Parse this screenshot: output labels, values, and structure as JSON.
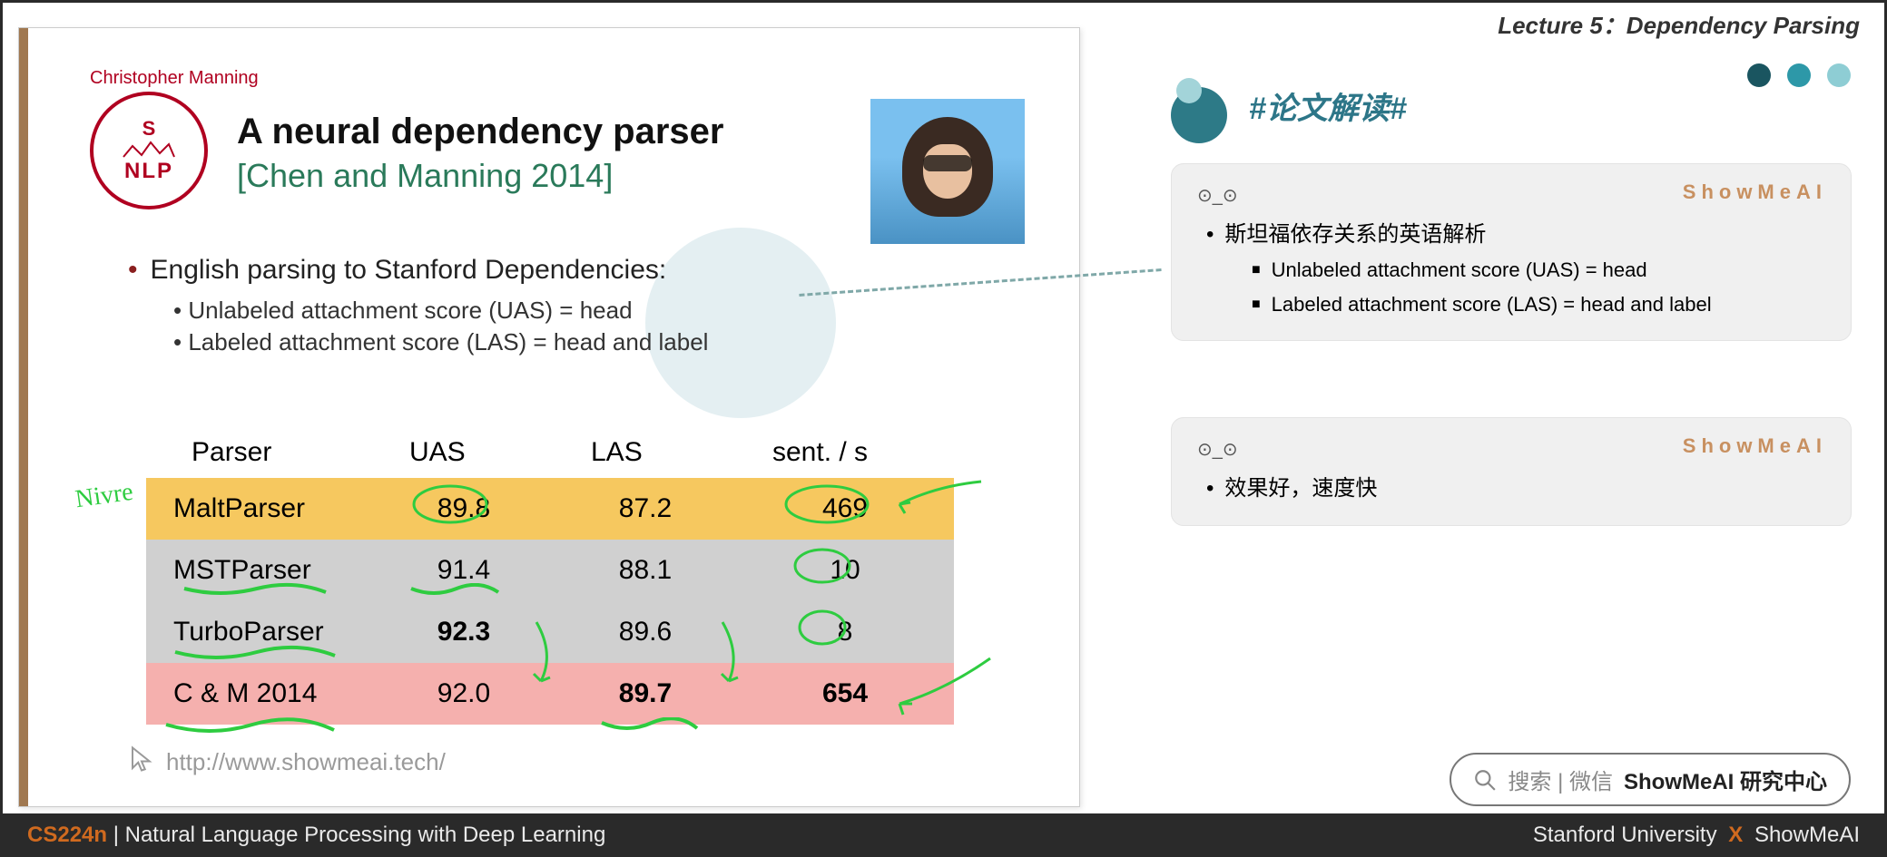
{
  "header": {
    "lecture": "Lecture 5：Dependency Parsing"
  },
  "slide": {
    "author": "Christopher Manning",
    "logo_top": "S",
    "logo_bottom": "NLP",
    "title": "A neural dependency parser",
    "subtitle": "[Chen and Manning 2014]",
    "bullet_main": "English parsing to Stanford Dependencies:",
    "sub1": "Unlabeled attachment score (UAS) = head",
    "sub2": "Labeled attachment score (LAS) = head and label",
    "hand_note": "Nivre",
    "url": "http://www.showmeai.tech/"
  },
  "chart_data": {
    "type": "table",
    "columns": [
      "Parser",
      "UAS",
      "LAS",
      "sent. / s"
    ],
    "rows": [
      {
        "parser": "MaltParser",
        "uas": "89.8",
        "las": "87.2",
        "sps": "469",
        "color": "yellow",
        "bold": []
      },
      {
        "parser": "MSTParser",
        "uas": "91.4",
        "las": "88.1",
        "sps": "10",
        "color": "gray",
        "bold": []
      },
      {
        "parser": "TurboParser",
        "uas": "92.3",
        "las": "89.6",
        "sps": "8",
        "color": "gray",
        "bold": [
          "uas"
        ]
      },
      {
        "parser": "C & M 2014",
        "uas": "92.0",
        "las": "89.7",
        "sps": "654",
        "color": "pink",
        "bold": [
          "las",
          "sps"
        ]
      }
    ]
  },
  "right": {
    "section_title": "#论文解读#",
    "brand": "ShowMeAI",
    "robot": "⊙_⊙",
    "card_a_main": "斯坦福依存关系的英语解析",
    "card_a_sub1": "Unlabeled attachment score (UAS) = head",
    "card_a_sub2": "Labeled attachment score (LAS) = head and label",
    "card_b_main": "效果好，速度快"
  },
  "search": {
    "icon": "search",
    "hint": "搜索 | 微信",
    "strong": "ShowMeAI 研究中心"
  },
  "footer": {
    "code": "CS224n",
    "sep": " | ",
    "course": "Natural Language Processing with Deep Learning",
    "right_a": "Stanford University",
    "right_x": "X",
    "right_b": "ShowMeAI"
  }
}
